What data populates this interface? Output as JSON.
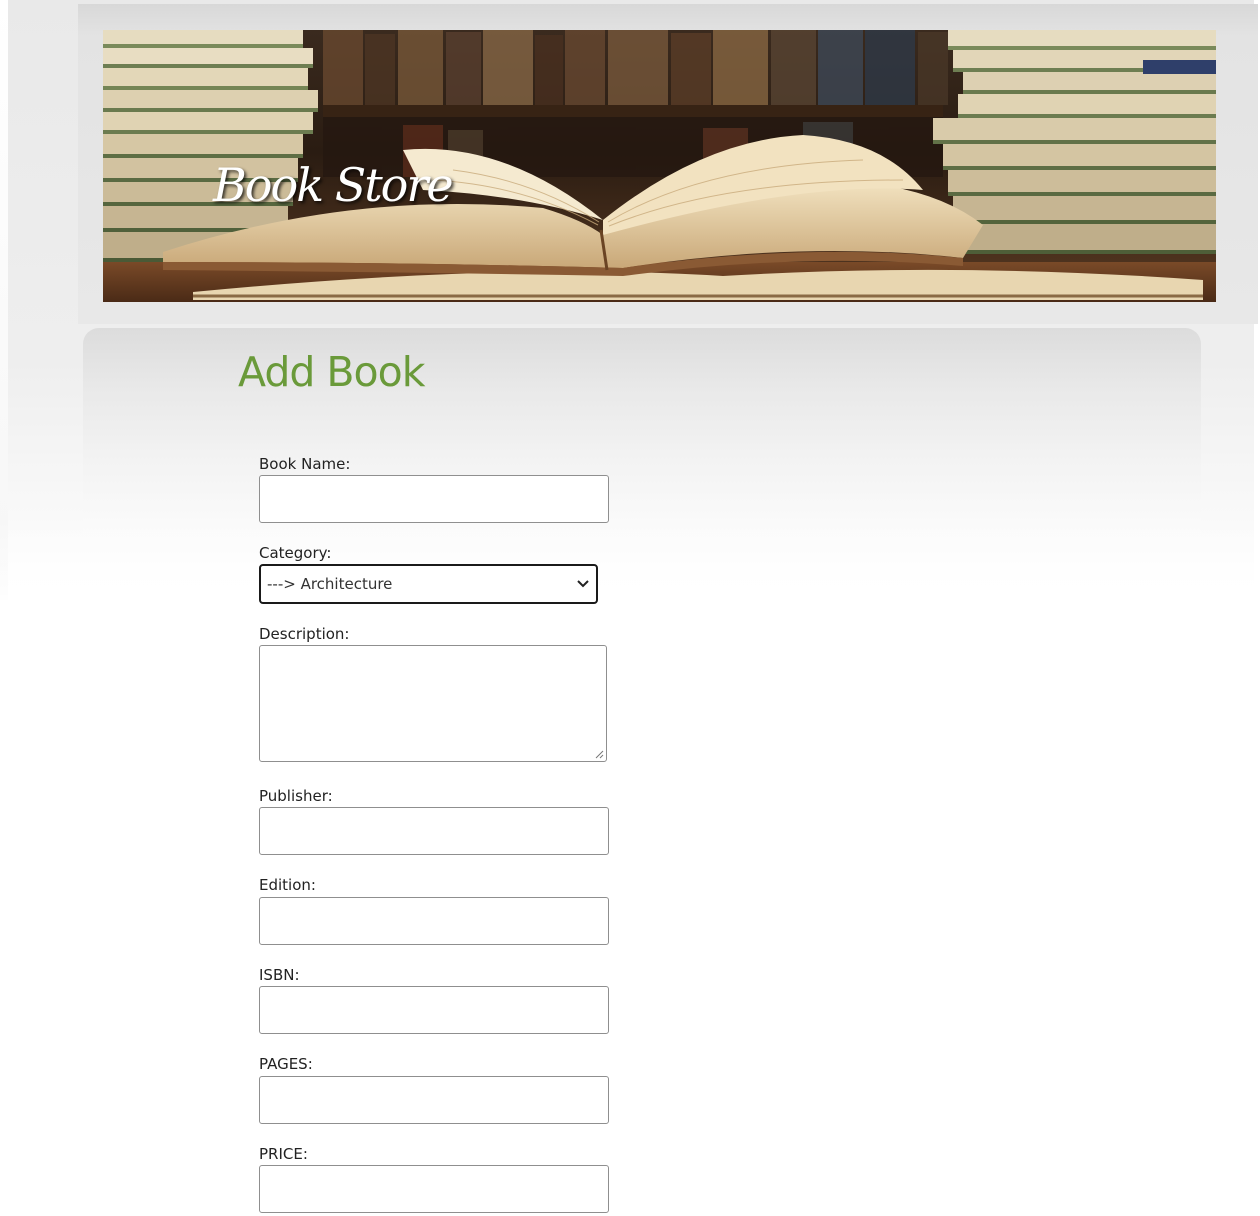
{
  "banner": {
    "title": "Book Store"
  },
  "form": {
    "title": "Add Book",
    "fields": {
      "book_name": {
        "label": "Book Name:",
        "value": ""
      },
      "category": {
        "label": "Category:",
        "value": "---> Architecture"
      },
      "description": {
        "label": "Description:",
        "value": ""
      },
      "publisher": {
        "label": "Publisher:",
        "value": ""
      },
      "edition": {
        "label": "Edition:",
        "value": ""
      },
      "isbn": {
        "label": "ISBN:",
        "value": ""
      },
      "pages": {
        "label": "PAGES:",
        "value": ""
      },
      "price": {
        "label": "PRICE:",
        "value": ""
      }
    }
  },
  "colors": {
    "title_green": "#6a9a3a",
    "label_text": "#222222",
    "input_border": "#8f8f8f",
    "select_border": "#1a1a1a"
  },
  "icons": {
    "select_arrow": "chevron-down-icon",
    "textarea_resize": "resize-handle-icon"
  }
}
